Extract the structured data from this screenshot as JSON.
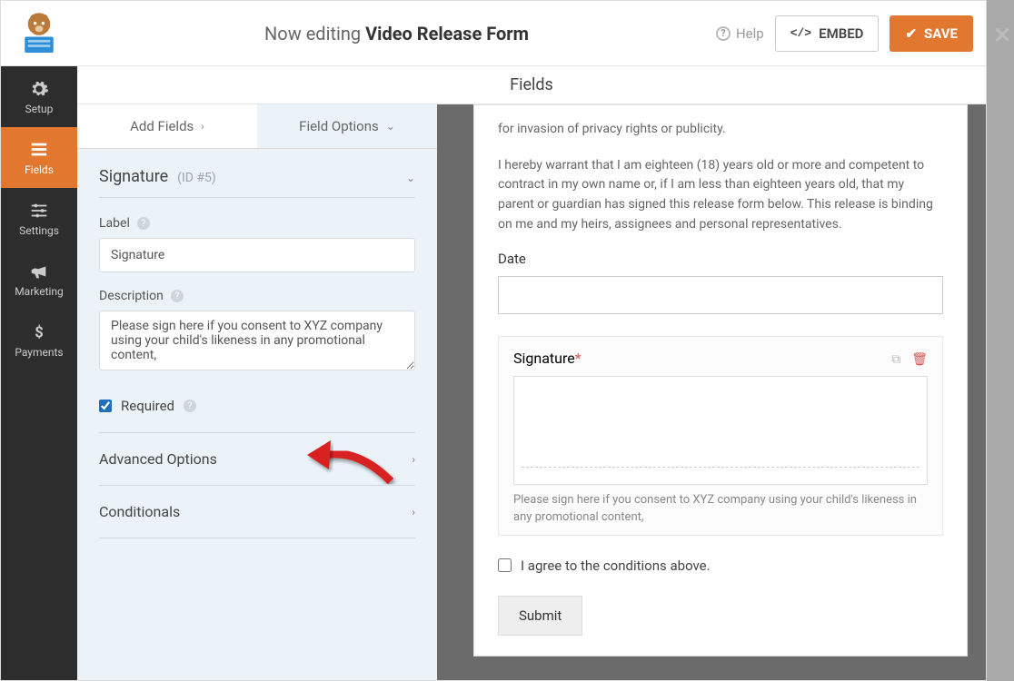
{
  "header": {
    "now_editing": "Now editing",
    "form_name": "Video Release Form",
    "help": "Help",
    "embed": "EMBED",
    "save": "SAVE"
  },
  "sidebar": {
    "items": [
      {
        "label": "Setup",
        "icon": "gear"
      },
      {
        "label": "Fields",
        "icon": "list"
      },
      {
        "label": "Settings",
        "icon": "sliders"
      },
      {
        "label": "Marketing",
        "icon": "bullhorn"
      },
      {
        "label": "Payments",
        "icon": "dollar"
      }
    ]
  },
  "section_title": "Fields",
  "tabs": {
    "add": "Add Fields",
    "options": "Field Options"
  },
  "field_options": {
    "name": "Signature",
    "id_label": "(ID #5)",
    "label_label": "Label",
    "label_value": "Signature",
    "desc_label": "Description",
    "desc_value": "Please sign here if you consent to XYZ company using your child's likeness in any promotional content,",
    "required_label": "Required",
    "required_checked": true,
    "advanced": "Advanced Options",
    "conditionals": "Conditionals"
  },
  "preview": {
    "para1": "for invasion of privacy rights or publicity.",
    "para2": "I hereby warrant that I am eighteen (18) years old or more and competent to contract in my own name or, if I am less than eighteen years old, that my parent or guardian has signed this release form below. This release is binding on me and my heirs, assignees and personal representatives.",
    "date_label": "Date",
    "signature_label": "Signature",
    "signature_desc": "Please sign here if you consent to XYZ company using your child's likeness in any promotional content,",
    "agree_label": "I agree to the conditions above.",
    "submit": "Submit"
  }
}
